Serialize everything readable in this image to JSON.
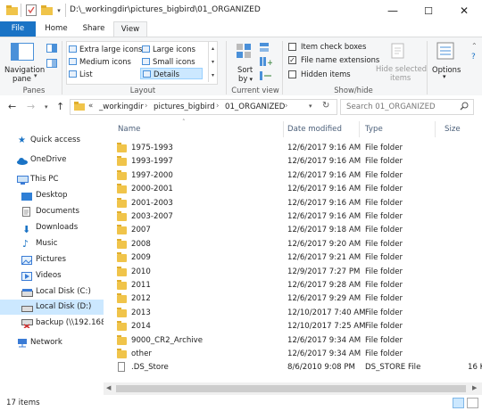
{
  "window": {
    "path_title": "D:\\_workingdir\\pictures_bigbird\\01_ORGANIZED",
    "minimize_glyph": "—",
    "maximize_glyph": "☐",
    "close_glyph": "✕"
  },
  "tabs": [
    "File",
    "Home",
    "Share",
    "View"
  ],
  "ribbon": {
    "panes": {
      "nav_pane_l1": "Navigation",
      "nav_pane_l2": "pane",
      "group": "Panes"
    },
    "layout": {
      "items": [
        "Extra large icons",
        "Large icons",
        "Medium icons",
        "Small icons",
        "List",
        "Details"
      ],
      "group": "Layout"
    },
    "current_view": {
      "sort_l1": "Sort",
      "sort_l2": "by",
      "group": "Current view"
    },
    "show_hide": {
      "item_check_boxes": "Item check boxes",
      "file_name_extensions": "File name extensions",
      "hidden_items": "Hidden items",
      "hide_selected_l1": "Hide selected",
      "hide_selected_l2": "items",
      "group": "Show/hide"
    },
    "options": "Options"
  },
  "address": {
    "prefix": "«",
    "crumbs": [
      "_workingdir",
      "pictures_bigbird",
      "01_ORGANIZED"
    ],
    "search_placeholder": "Search 01_ORGANIZED"
  },
  "nav": {
    "items": [
      {
        "label": "Quick access",
        "icon": "star-icon"
      },
      {
        "label": "OneDrive",
        "icon": "cloud-icon"
      },
      {
        "label": "This PC",
        "icon": "computer-icon"
      },
      {
        "label": "Desktop",
        "icon": "desktop-icon"
      },
      {
        "label": "Documents",
        "icon": "documents-icon"
      },
      {
        "label": "Downloads",
        "icon": "downloads-icon"
      },
      {
        "label": "Music",
        "icon": "music-icon"
      },
      {
        "label": "Pictures",
        "icon": "pictures-icon"
      },
      {
        "label": "Videos",
        "icon": "videos-icon"
      },
      {
        "label": "Local Disk (C:)",
        "icon": "drive-icon"
      },
      {
        "label": "Local Disk (D:)",
        "icon": "drive-icon",
        "selected": true
      },
      {
        "label": "backup (\\\\192.168.1",
        "icon": "network-drive-icon"
      },
      {
        "label": "Network",
        "icon": "network-icon"
      }
    ]
  },
  "columns": [
    "Name",
    "Date modified",
    "Type",
    "Size"
  ],
  "files": [
    {
      "name": "1975-1993",
      "date": "12/6/2017 9:16 AM",
      "type": "File folder",
      "size": ""
    },
    {
      "name": "1993-1997",
      "date": "12/6/2017 9:16 AM",
      "type": "File folder",
      "size": ""
    },
    {
      "name": "1997-2000",
      "date": "12/6/2017 9:16 AM",
      "type": "File folder",
      "size": ""
    },
    {
      "name": "2000-2001",
      "date": "12/6/2017 9:16 AM",
      "type": "File folder",
      "size": ""
    },
    {
      "name": "2001-2003",
      "date": "12/6/2017 9:16 AM",
      "type": "File folder",
      "size": ""
    },
    {
      "name": "2003-2007",
      "date": "12/6/2017 9:16 AM",
      "type": "File folder",
      "size": ""
    },
    {
      "name": "2007",
      "date": "12/6/2017 9:18 AM",
      "type": "File folder",
      "size": ""
    },
    {
      "name": "2008",
      "date": "12/6/2017 9:20 AM",
      "type": "File folder",
      "size": ""
    },
    {
      "name": "2009",
      "date": "12/6/2017 9:21 AM",
      "type": "File folder",
      "size": ""
    },
    {
      "name": "2010",
      "date": "12/9/2017 7:27 PM",
      "type": "File folder",
      "size": ""
    },
    {
      "name": "2011",
      "date": "12/6/2017 9:28 AM",
      "type": "File folder",
      "size": ""
    },
    {
      "name": "2012",
      "date": "12/6/2017 9:29 AM",
      "type": "File folder",
      "size": ""
    },
    {
      "name": "2013",
      "date": "12/10/2017 7:40 AM",
      "type": "File folder",
      "size": ""
    },
    {
      "name": "2014",
      "date": "12/10/2017 7:25 AM",
      "type": "File folder",
      "size": ""
    },
    {
      "name": "9000_CR2_Archive",
      "date": "12/6/2017 9:34 AM",
      "type": "File folder",
      "size": ""
    },
    {
      "name": "other",
      "date": "12/6/2017 9:34 AM",
      "type": "File folder",
      "size": ""
    },
    {
      "name": ".DS_Store",
      "date": "8/6/2010 9:08 PM",
      "type": "DS_STORE File",
      "size": "16 K"
    }
  ],
  "status": {
    "count": "17 items"
  }
}
